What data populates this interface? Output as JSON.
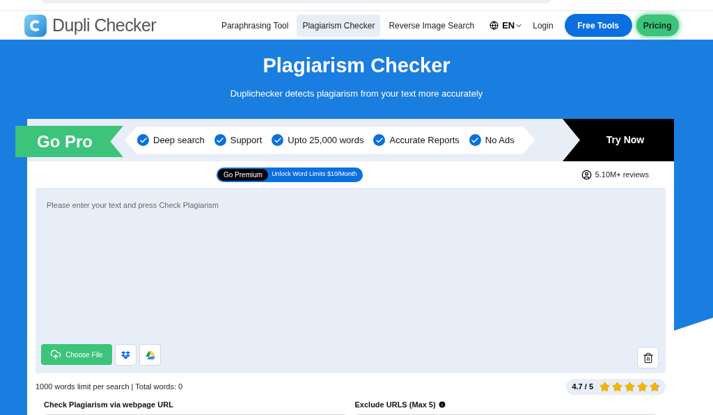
{
  "header": {
    "logo_text": "Dupli Checker",
    "nav": [
      {
        "label": "Paraphrasing Tool",
        "selected": false
      },
      {
        "label": "Plagiarism Checker",
        "selected": true
      },
      {
        "label": "Reverse Image Search",
        "selected": false
      }
    ],
    "language": "EN",
    "login": "Login",
    "free_tools": "Free Tools",
    "pricing": "Pricing"
  },
  "hero": {
    "title": "Plagiarism Checker",
    "subtitle": "Duplichecker detects plagiarism from your text more accurately"
  },
  "promo": {
    "badge": "Go Pro",
    "features": [
      "Deep search",
      "Support",
      "Upto 25,000 words",
      "Accurate Reports",
      "No Ads"
    ],
    "cta": "Try Now"
  },
  "premium": {
    "label": "Go Premium",
    "offer": "Unlock Word Limits $10/Month"
  },
  "reviews": "5.10M+ reviews",
  "editor": {
    "placeholder": "Please enter your text and press Check Plagiarism",
    "choose_file": "Choose File"
  },
  "limit_text": "1000 words limit per search | Total words: 0",
  "rating": {
    "text": "4.7 / 5",
    "stars": 4.7
  },
  "url_sections": [
    {
      "label": "Check Plagiarism via webpage URL",
      "info": false
    },
    {
      "label": "Exclude URLS (Max 5)",
      "info": true
    }
  ]
}
